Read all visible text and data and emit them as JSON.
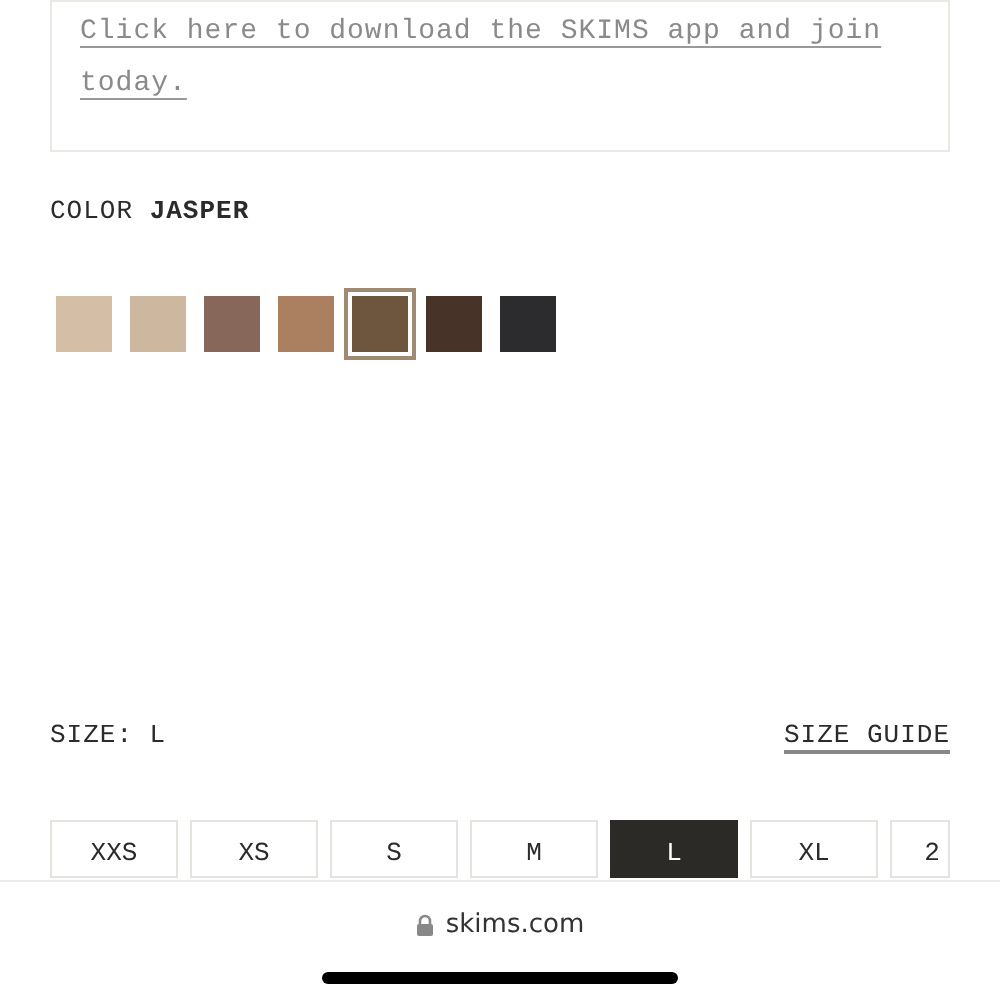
{
  "promo": {
    "link": "Click here to download the SKIMS app and join today."
  },
  "color": {
    "label": "COLOR",
    "value": "JASPER",
    "swatches": [
      {
        "color": "#d4bfa6",
        "selected": false
      },
      {
        "color": "#cdb89f",
        "selected": false
      },
      {
        "color": "#87675a",
        "selected": false
      },
      {
        "color": "#ab8060",
        "selected": false
      },
      {
        "color": "#6d553e",
        "selected": true
      },
      {
        "color": "#483329",
        "selected": false
      },
      {
        "color": "#2c2c2e",
        "selected": false
      }
    ]
  },
  "size": {
    "label": "SIZE: L",
    "guide": "SIZE GUIDE",
    "options": [
      {
        "label": "XXS",
        "selected": false
      },
      {
        "label": "XS",
        "selected": false
      },
      {
        "label": "S",
        "selected": false
      },
      {
        "label": "M",
        "selected": false
      },
      {
        "label": "L",
        "selected": true
      },
      {
        "label": "XL",
        "selected": false
      },
      {
        "label": "2",
        "selected": false
      }
    ]
  },
  "browser": {
    "url": "skims.com"
  }
}
